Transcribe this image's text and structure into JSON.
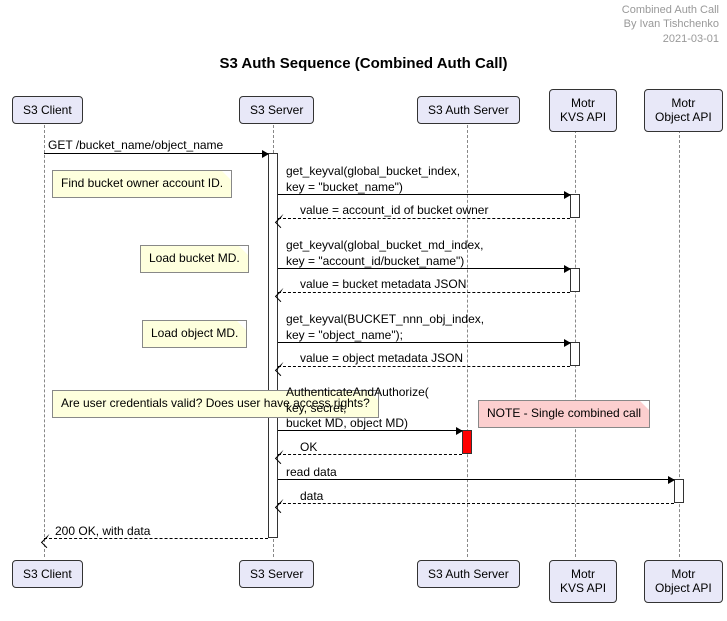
{
  "meta": {
    "l1": "Combined Auth Call",
    "l2": "By Ivan Tishchenko",
    "l3": "2021-03-01"
  },
  "title": "S3 Auth Sequence (Combined Auth Call)",
  "p": {
    "client": "S3 Client",
    "server": "S3 Server",
    "auth": "S3 Auth Server",
    "kvs": "Motr\nKVS API",
    "obj": "Motr\nObject API"
  },
  "m": {
    "get": "GET /bucket_name/object_name",
    "n1": "Find bucket owner account ID.",
    "kv1": "get_keyval(global_bucket_index,\n      key = \"bucket_name\")",
    "kv1r": "value = account_id of bucket owner",
    "n2": "Load bucket MD.",
    "kv2": "get_keyval(global_bucket_md_index,\n      key = \"account_id/bucket_name\")",
    "kv2r": "value = bucket metadata JSON",
    "n3": "Load object MD.",
    "kv3": "get_keyval(BUCKET_nnn_obj_index,\n      key = \"object_name\");",
    "kv3r": "value = object metadata JSON",
    "n4": "Are user credentials valid?\nDoes user have access rights?",
    "auth": "AuthenticateAndAuthorize(\n      key, secret,\n      bucket MD, object MD)",
    "note": "NOTE - Single combined call",
    "ok": "OK",
    "read": "read data",
    "data": "data",
    "resp": "200 OK, with data"
  }
}
